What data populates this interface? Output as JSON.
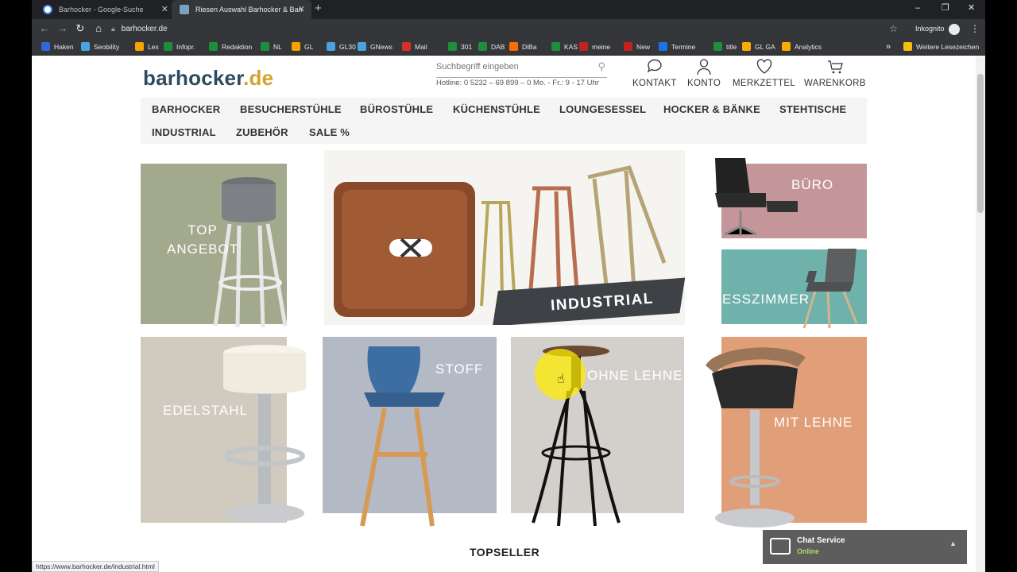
{
  "browser": {
    "tabs": [
      {
        "title": "Barhocker - Google-Suche",
        "close": "✕"
      },
      {
        "title": "Riesen Auswahl Barhocker & Ban",
        "close": "✕"
      }
    ],
    "new_tab": "+",
    "window_controls": {
      "minimize": "–",
      "maximize": "❐",
      "close": "✕"
    },
    "url": "barhocker.de",
    "incognito_label": "Inkognito",
    "bookmarks": [
      {
        "label": "Haken",
        "color": "#3367d6"
      },
      {
        "label": "Seobility",
        "color": "#4aa3df"
      },
      {
        "label": "Lex",
        "color": "#f4a300"
      },
      {
        "label": "Infopr.",
        "color": "#1e8e3e"
      },
      {
        "label": "Redaktion",
        "color": "#1e8e3e"
      },
      {
        "label": "NL",
        "color": "#1e8e3e"
      },
      {
        "label": "GL",
        "color": "#f4a300"
      },
      {
        "label": "GL30",
        "color": "#4aa3df"
      },
      {
        "label": "GNews",
        "color": "#4aa3df"
      },
      {
        "label": "Mail",
        "color": "#d93025"
      },
      {
        "label": "301",
        "color": "#1e8e3e"
      },
      {
        "label": "DAB",
        "color": "#1e8e3e"
      },
      {
        "label": "DiBa",
        "color": "#ff6d00"
      },
      {
        "label": "KAS",
        "color": "#1e8e3e"
      },
      {
        "label": "meine",
        "color": "#c5221f"
      },
      {
        "label": "New",
        "color": "#c5221f"
      },
      {
        "label": "Termine",
        "color": "#1a73e8"
      },
      {
        "label": "title",
        "color": "#1e8e3e"
      },
      {
        "label": "GL GA",
        "color": "#f9ab00"
      },
      {
        "label": "Analytics",
        "color": "#f9ab00"
      }
    ],
    "bookmarks_more": "»",
    "other_bookmarks": "Weitere Lesezeichen",
    "status_url": "https://www.barhocker.de/industrial.html"
  },
  "site": {
    "logo_main": "barhocker",
    "logo_tld": ".de",
    "search_placeholder": "Suchbegriff eingeben",
    "hotline": "Hotline: 0 5232 – 69 899 – 0   Mo. - Fr.: 9 - 17 Uhr",
    "header_icons": [
      {
        "label": "KONTAKT",
        "icon": "chat-bubble-icon"
      },
      {
        "label": "KONTO",
        "icon": "user-icon"
      },
      {
        "label": "MERKZETTEL",
        "icon": "heart-icon"
      },
      {
        "label": "WARENKORB",
        "icon": "cart-icon"
      }
    ],
    "nav": [
      "BARHOCKER",
      "BESUCHERSTÜHLE",
      "BÜROSTÜHLE",
      "KÜCHENSTÜHLE",
      "LOUNGESESSEL",
      "HOCKER & BÄNKE",
      "STEHTISCHE",
      "INDUSTRIAL",
      "ZUBEHÖR",
      "SALE %"
    ],
    "tiles": {
      "top_angebot": "TOP\nANGEBOT",
      "industrial": "INDUSTRIAL",
      "buero": "BÜRO",
      "esszimmer": "ESSZIMMER",
      "edelstahl": "EDELSTAHL",
      "stoff": "STOFF",
      "ohne_lehne": "OHNE LEHNE",
      "mit_lehne": "MIT LEHNE"
    },
    "tile_colors": {
      "top_angebot": "#a3a98c",
      "buero": "#c4969a",
      "esszimmer": "#6fb2ac",
      "edelstahl": "#d1cbbf",
      "stoff": "#b3bac6",
      "ohne_lehne": "#d3d0cc",
      "mit_lehne": "#e09f79"
    },
    "topseller": "TOPSELLER",
    "chat": {
      "title": "Chat Service",
      "status": "Online"
    }
  }
}
